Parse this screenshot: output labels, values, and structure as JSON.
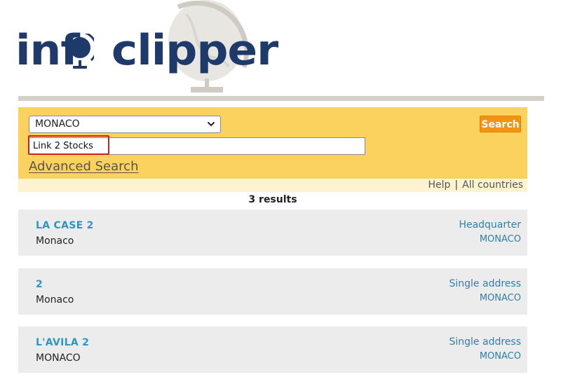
{
  "brand": {
    "logo_left": "inf",
    "logo_right": "clipper",
    "logo_aria": "infoclipper",
    "color_primary": "#1e3a6b",
    "color_accent": "#2f95c4"
  },
  "search": {
    "country_selected": "MONACO",
    "query_value": "Link 2 Stocks",
    "search_button_label": "Search",
    "advanced_link_label": "Advanced Search",
    "panel_color": "#fad25d",
    "button_color": "#f29411"
  },
  "sub_nav": {
    "help_label": "Help",
    "separator": "|",
    "all_countries_label": "All countries"
  },
  "results": {
    "count_label": "3 results",
    "items": [
      {
        "name": "LA CASE 2",
        "city": "Monaco",
        "type": "Headquarter",
        "country": "MONACO"
      },
      {
        "name": "2",
        "city": "Monaco",
        "type": "Single address",
        "country": "MONACO"
      },
      {
        "name": "L'AVILA 2",
        "city": "MONACO",
        "type": "Single address",
        "country": "MONACO"
      }
    ]
  },
  "icons": {
    "globe": "globe-icon",
    "select_arrow": "chevron-down-icon"
  }
}
